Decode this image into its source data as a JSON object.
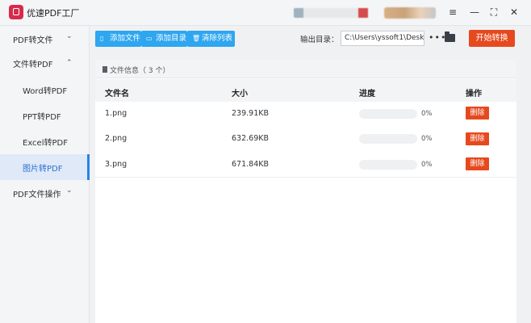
{
  "app": {
    "title": "优速PDF工厂"
  },
  "window_controls": {
    "menu": "≡",
    "minimize": "—",
    "maximize": "⛶",
    "close": "✕"
  },
  "sidebar": {
    "items": [
      {
        "label": "PDF转文件",
        "chevron": "⌄"
      },
      {
        "label": "文件转PDF",
        "chevron": "⌃"
      },
      {
        "label": "Word转PDF"
      },
      {
        "label": "PPT转PDF"
      },
      {
        "label": "Excel转PDF"
      },
      {
        "label": "图片转PDF",
        "active": true
      },
      {
        "label": "PDF文件操作",
        "chevron": "⌄"
      }
    ]
  },
  "toolbar": {
    "add_file": "添加文件",
    "add_folder": "添加目录",
    "clear_list": "清除列表",
    "output_label": "输出目录：",
    "output_path": "C:\\Users\\yssoft1\\Deskt",
    "more": "•••",
    "start": "开始转换"
  },
  "panel": {
    "title": "文件信息（ 3 个）",
    "columns": {
      "name": "文件名",
      "size": "大小",
      "progress": "进度",
      "action": "操作"
    },
    "rows": [
      {
        "name": "1.png",
        "size": "239.91KB",
        "progress": "0%",
        "action": "删除"
      },
      {
        "name": "2.png",
        "size": "632.69KB",
        "progress": "0%",
        "action": "删除"
      },
      {
        "name": "3.png",
        "size": "671.84KB",
        "progress": "0%",
        "action": "删除"
      }
    ]
  },
  "colors": {
    "accent": "#2ea6f0",
    "danger": "#e6491e",
    "active_text": "#2a6fd6"
  }
}
